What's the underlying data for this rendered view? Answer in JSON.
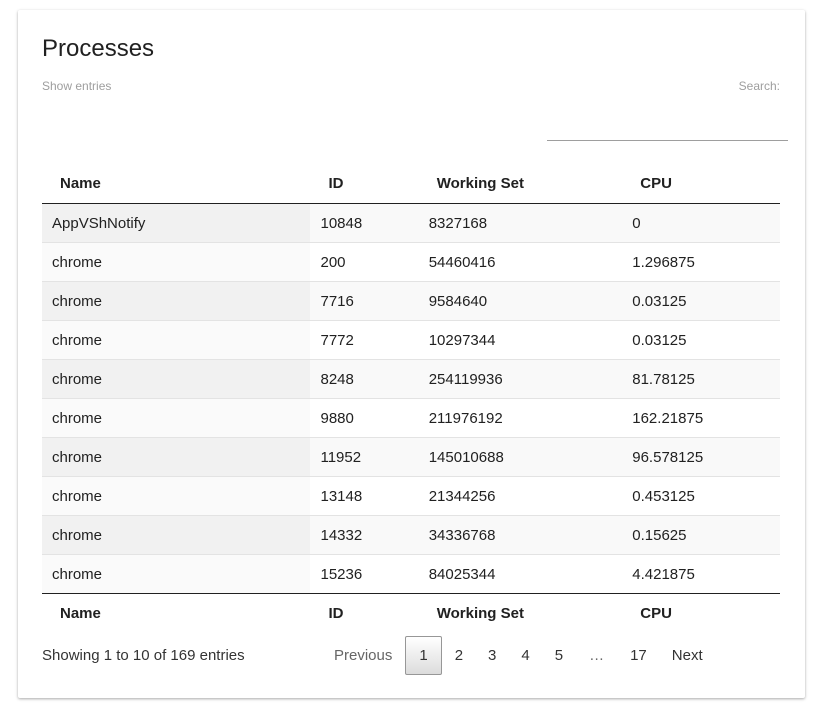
{
  "page": {
    "title": "Processes",
    "show_entries_label": "Show entries",
    "search_label": "Search:",
    "search_value": ""
  },
  "table": {
    "columns": [
      "Name",
      "ID",
      "Working Set",
      "CPU"
    ],
    "rows": [
      {
        "name": "AppVShNotify",
        "id": "10848",
        "working_set": "8327168",
        "cpu": "0"
      },
      {
        "name": "chrome",
        "id": "200",
        "working_set": "54460416",
        "cpu": "1.296875"
      },
      {
        "name": "chrome",
        "id": "7716",
        "working_set": "9584640",
        "cpu": "0.03125"
      },
      {
        "name": "chrome",
        "id": "7772",
        "working_set": "10297344",
        "cpu": "0.03125"
      },
      {
        "name": "chrome",
        "id": "8248",
        "working_set": "254119936",
        "cpu": "81.78125"
      },
      {
        "name": "chrome",
        "id": "9880",
        "working_set": "211976192",
        "cpu": "162.21875"
      },
      {
        "name": "chrome",
        "id": "11952",
        "working_set": "145010688",
        "cpu": "96.578125"
      },
      {
        "name": "chrome",
        "id": "13148",
        "working_set": "21344256",
        "cpu": "0.453125"
      },
      {
        "name": "chrome",
        "id": "14332",
        "working_set": "34336768",
        "cpu": "0.15625"
      },
      {
        "name": "chrome",
        "id": "15236",
        "working_set": "84025344",
        "cpu": "4.421875"
      }
    ]
  },
  "footer": {
    "info": "Showing 1 to 10 of 169 entries",
    "pagination": {
      "previous": "Previous",
      "next": "Next",
      "pages": [
        "1",
        "2",
        "3",
        "4",
        "5",
        "…",
        "17"
      ],
      "current": "1"
    }
  }
}
